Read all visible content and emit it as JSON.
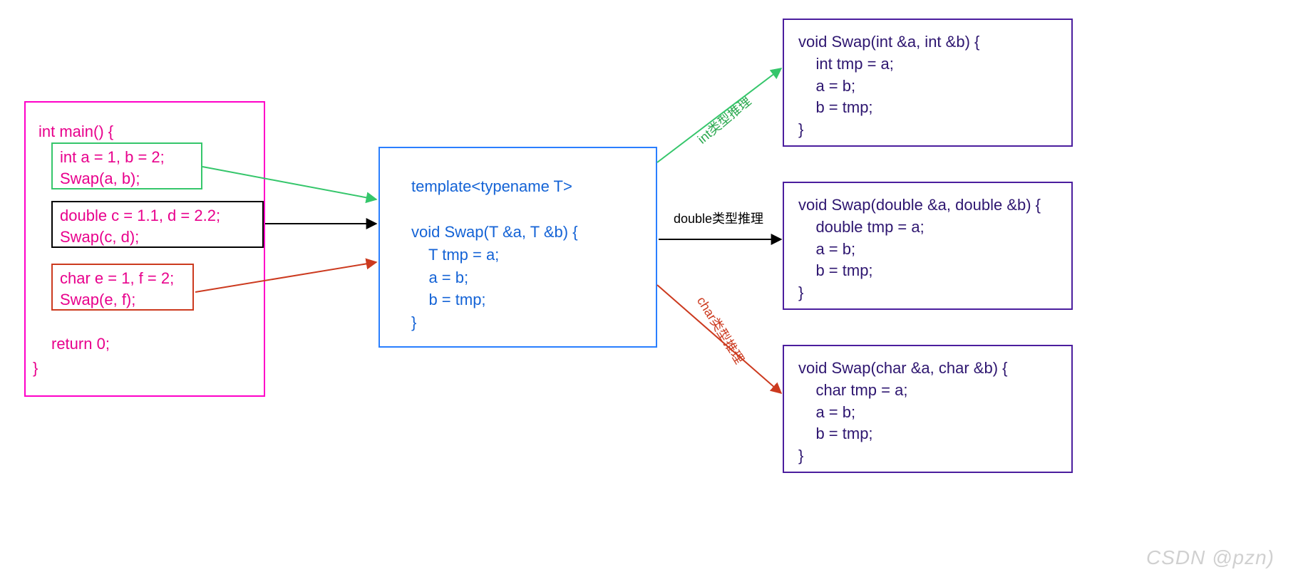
{
  "main": {
    "title": "int main() {",
    "block_int": "int a = 1, b = 2;\nSwap(a, b);",
    "block_double": "double c = 1.1, d = 2.2;\nSwap(c, d);",
    "block_char": "char e = 1, f = 2;\nSwap(e, f);",
    "return_line": "return 0;",
    "close": "}"
  },
  "template": {
    "code": "template<typename T>\n\nvoid Swap(T &a, T &b) {\n    T tmp = a;\n    a = b;\n    b = tmp;\n}"
  },
  "arrows": {
    "int_label": "int类型推理",
    "double_label": "double类型推理",
    "char_label": "char类型推理"
  },
  "instantiations": {
    "int": "void Swap(int &a, int &b) {\n    int tmp = a;\n    a = b;\n    b = tmp;\n}",
    "double": "void Swap(double &a, double &b) {\n    double tmp = a;\n    a = b;\n    b = tmp;\n}",
    "char": "void Swap(char &a, char &b) {\n    char tmp = a;\n    a = b;\n    b = tmp;\n}"
  },
  "watermark": "CSDN @pzn)"
}
